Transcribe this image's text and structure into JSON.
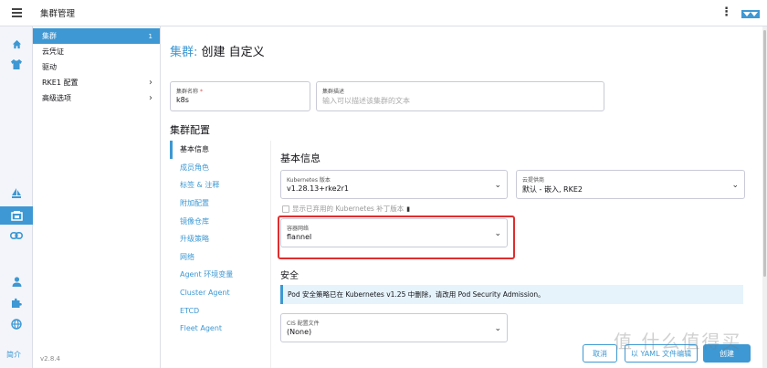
{
  "header": {
    "title": "集群管理",
    "more_icon": "kebab-menu-icon"
  },
  "rail": {
    "icons": [
      "home-icon",
      "tshirt-icon",
      "sailboat-icon",
      "cluster-icon",
      "link-icon",
      "user-icon",
      "extension-icon",
      "globe-icon"
    ],
    "about_label": "简介"
  },
  "sidenav": {
    "items": [
      {
        "label": "集群",
        "count": "1",
        "active": true
      },
      {
        "label": "云凭证"
      },
      {
        "label": "驱动"
      },
      {
        "label": "RKE1 配置",
        "chevron": "›"
      },
      {
        "label": "高级选项",
        "chevron": "›"
      }
    ],
    "version": "v2.8.4"
  },
  "page": {
    "title_prefix": "集群:",
    "title_rest": " 创建 自定义"
  },
  "form": {
    "name": {
      "label": "集群名称",
      "required_mark": "*",
      "value": "k8s"
    },
    "description": {
      "label": "集群描述",
      "placeholder": "输入可以描述该集群的文本"
    }
  },
  "cluster_config": {
    "title": "集群配置",
    "tabs": [
      "基本信息",
      "成员角色",
      "标签 & 注释",
      "附加配置",
      "镜像仓库",
      "升级策略",
      "网络",
      "Agent 环境变量",
      "Cluster Agent",
      "ETCD",
      "Fleet Agent"
    ],
    "basic": {
      "title": "基本信息",
      "k8s_version": {
        "label": "Kubernetes 版本",
        "value": "v1.28.13+rke2r1"
      },
      "cloud_provider": {
        "label": "云提供商",
        "value": "默认 - 嵌入, RKE2"
      },
      "show_deprecated": "显示已弃用的 Kubernetes 补丁版本",
      "cni": {
        "label": "容器网络",
        "value": "flannel"
      }
    },
    "security": {
      "title": "安全",
      "banner": "Pod 安全策略已在 Kubernetes v1.25 中删除，请改用 Pod Security Admission。",
      "cis": {
        "label": "CIS 配置文件",
        "value": "(None)"
      }
    }
  },
  "footer": {
    "cancel": "取消",
    "yaml": "以 YAML 文件编辑",
    "create": "创建"
  },
  "watermark": "值 什么值得买",
  "colors": {
    "accent": "#3d98d3",
    "highlight": "#e02d2d"
  }
}
